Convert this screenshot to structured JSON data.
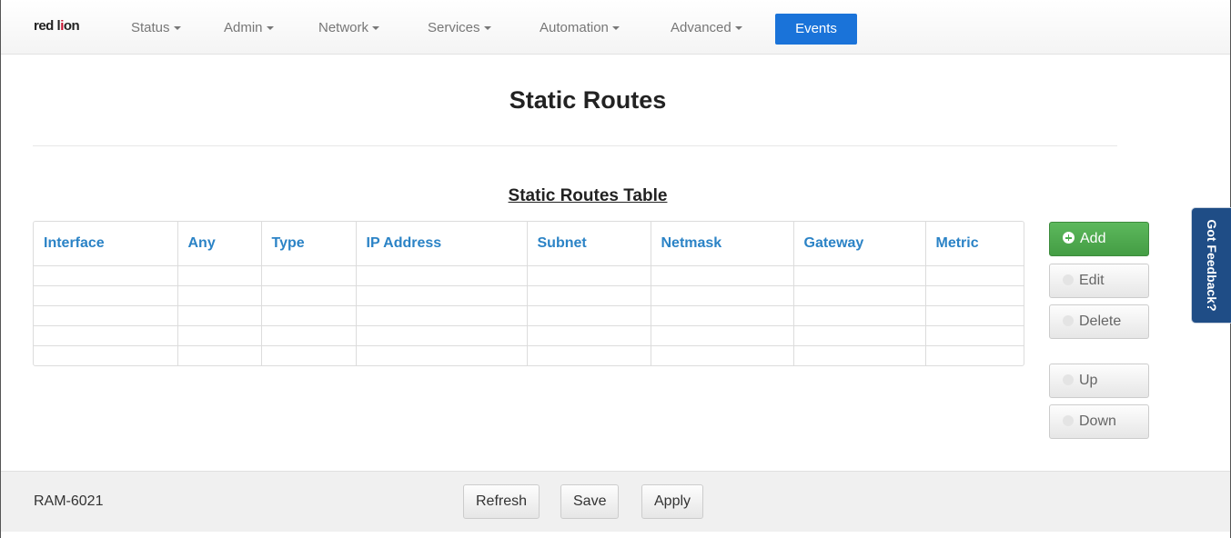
{
  "brand": {
    "logo_text_left": "red l",
    "logo_mark": "i",
    "logo_text_right": "on"
  },
  "nav": {
    "items": [
      {
        "label": "Status"
      },
      {
        "label": "Admin"
      },
      {
        "label": "Network"
      },
      {
        "label": "Services"
      },
      {
        "label": "Automation"
      },
      {
        "label": "Advanced"
      }
    ],
    "active": {
      "label": "Events"
    },
    "active_color": "#1a73d9"
  },
  "page": {
    "title": "Static Routes",
    "table_title": "Static Routes Table"
  },
  "table": {
    "columns": [
      "Interface",
      "Any",
      "Type",
      "IP Address",
      "Subnet",
      "Netmask",
      "Gateway",
      "Metric"
    ],
    "rows": [
      [
        "",
        "",
        "",
        "",
        "",
        "",
        "",
        ""
      ],
      [
        "",
        "",
        "",
        "",
        "",
        "",
        "",
        ""
      ],
      [
        "",
        "",
        "",
        "",
        "",
        "",
        "",
        ""
      ],
      [
        "",
        "",
        "",
        "",
        "",
        "",
        "",
        ""
      ],
      [
        "",
        "",
        "",
        "",
        "",
        "",
        "",
        ""
      ]
    ],
    "header_color": "#2b83c6"
  },
  "actions": {
    "add": {
      "label": "Add",
      "icon": "plus-circle-icon",
      "color": "#5cb85c"
    },
    "edit": {
      "label": "Edit",
      "icon": "check-circle-icon"
    },
    "delete": {
      "label": "Delete",
      "icon": "minus-circle-icon"
    },
    "up": {
      "label": "Up",
      "icon": "up-circle-icon"
    },
    "down": {
      "label": "Down",
      "icon": "down-circle-icon"
    }
  },
  "feedback": {
    "label": "Got Feedback?",
    "color": "#1f4d86"
  },
  "footer": {
    "device": "RAM-6021",
    "refresh": "Refresh",
    "save": "Save",
    "apply": "Apply"
  }
}
